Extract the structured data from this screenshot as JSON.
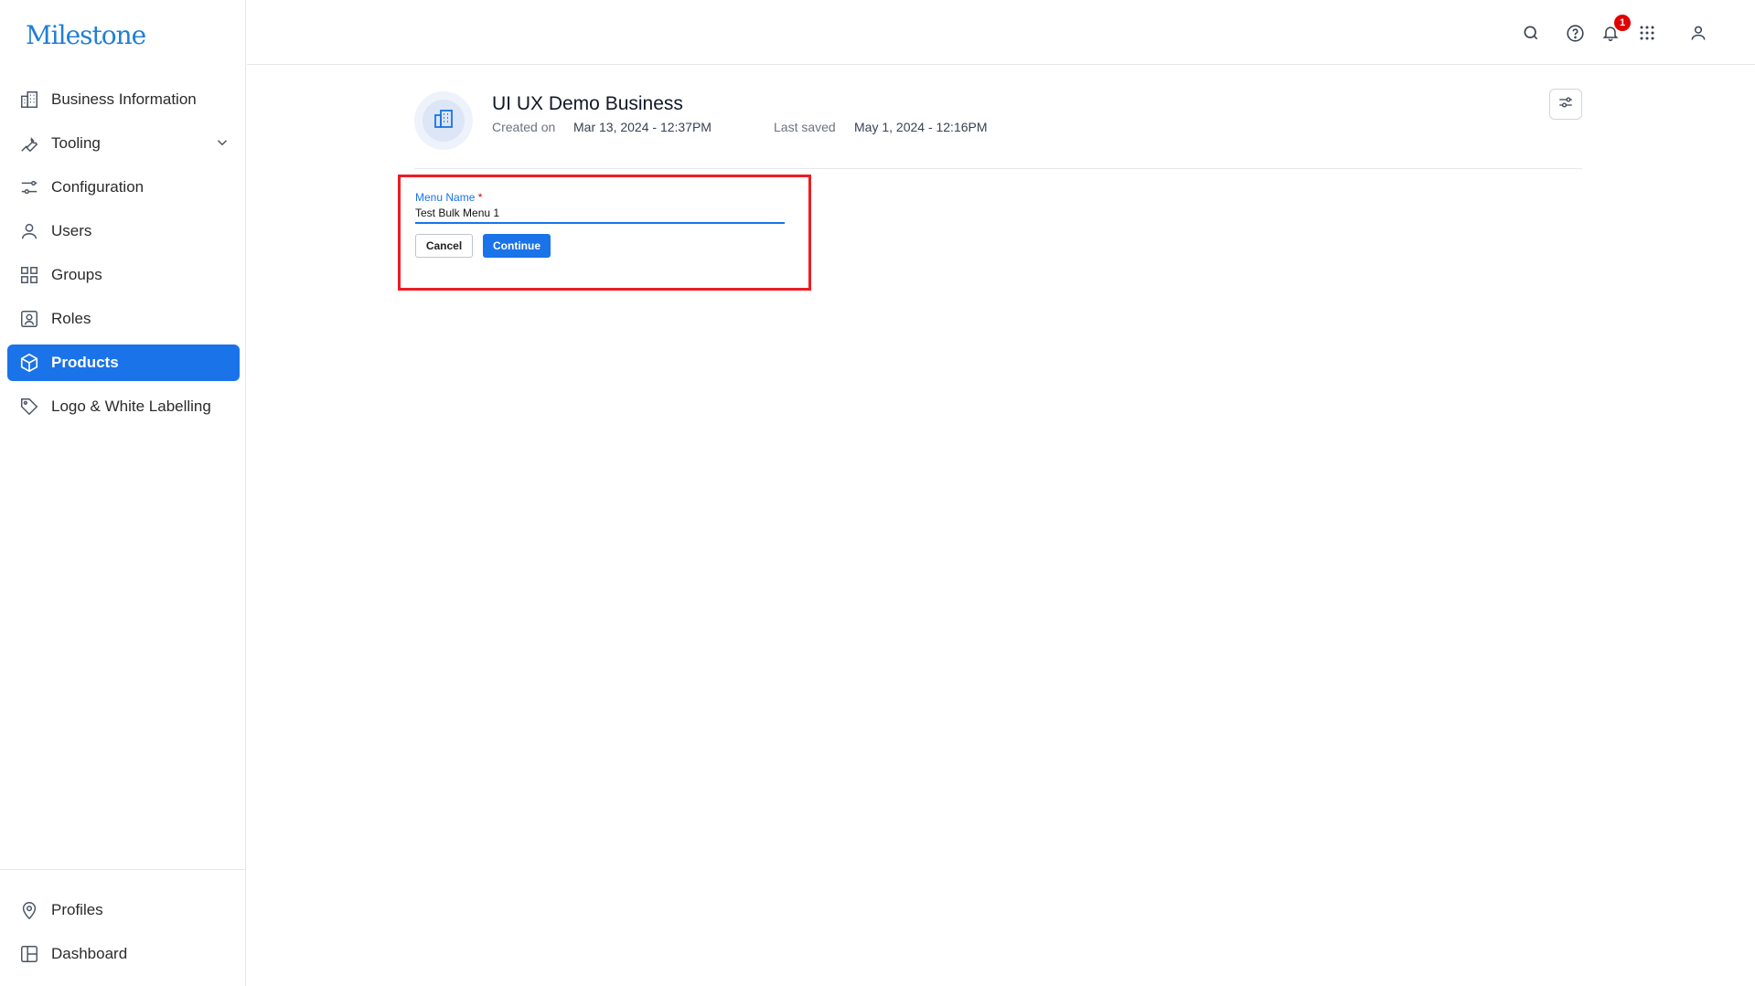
{
  "app": {
    "logo": "Milestone"
  },
  "sidebar": {
    "items": [
      {
        "label": "Business Information",
        "icon": "building-icon"
      },
      {
        "label": "Tooling",
        "icon": "wrench-icon"
      },
      {
        "label": "Configuration",
        "icon": "sliders-icon"
      },
      {
        "label": "Users",
        "icon": "user-icon"
      },
      {
        "label": "Groups",
        "icon": "grid-icon"
      },
      {
        "label": "Roles",
        "icon": "id-badge-icon"
      },
      {
        "label": "Products",
        "icon": "box-icon",
        "active": true
      },
      {
        "label": "Logo & White Labelling",
        "icon": "tag-icon"
      }
    ],
    "bottom_items": [
      {
        "label": "Profiles",
        "icon": "map-pin-icon"
      },
      {
        "label": "Dashboard",
        "icon": "layout-icon"
      }
    ]
  },
  "topbar": {
    "icons": [
      "search-icon",
      "help-icon",
      "bell-icon",
      "apps-grid-icon",
      "account-icon"
    ],
    "notification_count": "1"
  },
  "business": {
    "name": "UI UX Demo Business",
    "created_label": "Created on",
    "created_value": "Mar 13, 2024 - 12:37PM",
    "saved_label": "Last saved",
    "saved_value": "May 1, 2024 - 12:16PM"
  },
  "form": {
    "label": "Menu Name",
    "required_mark": "*",
    "value": "Test Bulk Menu 1",
    "cancel_label": "Cancel",
    "continue_label": "Continue"
  },
  "colors": {
    "accent": "#1a73e8",
    "highlight": "#ee1c24",
    "badge": "#e00000"
  }
}
